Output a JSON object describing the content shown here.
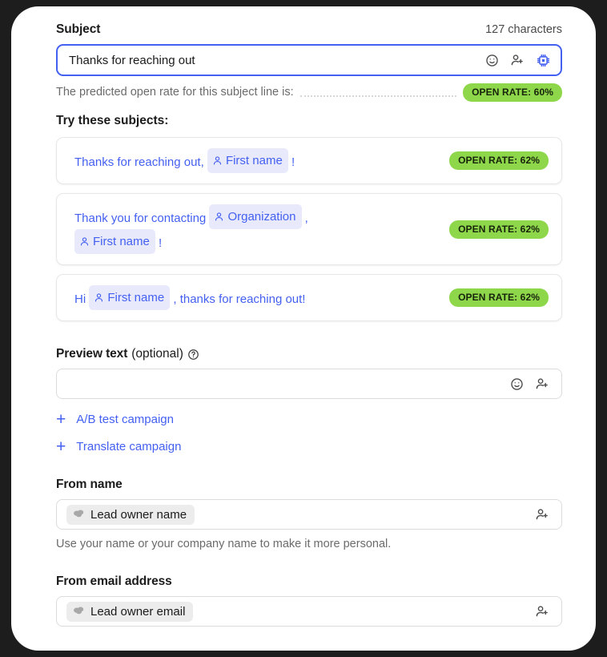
{
  "subject": {
    "label": "Subject",
    "char_count": "127 characters",
    "value": "Thanks for reaching out",
    "placeholder": "",
    "icons": [
      "emoji-icon",
      "personalize-icon",
      "ai-chip-icon"
    ]
  },
  "prediction": {
    "text": "The predicted open rate for this subject line is:",
    "badge": "OPEN RATE: 60%"
  },
  "suggestions": {
    "heading": "Try these subjects:",
    "items": [
      {
        "parts": [
          {
            "type": "text",
            "value": "Thanks for reaching out,"
          },
          {
            "type": "chip",
            "value": "First name"
          },
          {
            "type": "text",
            "value": "!"
          }
        ],
        "badge": "OPEN RATE: 62%"
      },
      {
        "parts": [
          {
            "type": "text",
            "value": "Thank you for contacting"
          },
          {
            "type": "chip",
            "value": "Organization"
          },
          {
            "type": "text",
            "value": ","
          },
          {
            "type": "break",
            "value": ""
          },
          {
            "type": "chip",
            "value": "First name"
          },
          {
            "type": "text",
            "value": "!"
          }
        ],
        "badge": "OPEN RATE: 62%"
      },
      {
        "parts": [
          {
            "type": "text",
            "value": "Hi"
          },
          {
            "type": "chip",
            "value": "First name"
          },
          {
            "type": "text",
            "value": ", thanks for reaching out!"
          }
        ],
        "badge": "OPEN RATE: 62%"
      }
    ]
  },
  "preview_text": {
    "label": "Preview text",
    "optional": "(optional)",
    "help_icon": "help-circle-icon",
    "value": "",
    "placeholder": ""
  },
  "actions": {
    "ab_test": "A/B test campaign",
    "translate": "Translate campaign",
    "plus": "+"
  },
  "from_name": {
    "label": "From name",
    "token": "Lead owner name",
    "helper": "Use your name or your company name to make it more personal."
  },
  "from_email": {
    "label": "From email address",
    "token": "Lead owner email"
  },
  "colors": {
    "accent_blue": "#4460f1",
    "badge_green": "#8ed74b",
    "chip_blue_bg": "#e8eafc",
    "chip_gray_bg": "#ececec",
    "text_dark": "#1b1b1b",
    "text_muted": "#6b6b6b",
    "page_bg": "#1d1d1d"
  }
}
